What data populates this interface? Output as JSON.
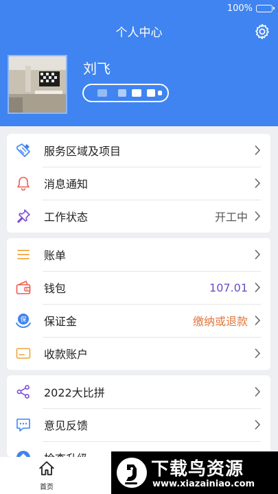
{
  "status_bar": {
    "battery": "100%"
  },
  "header": {
    "title": "个人中心",
    "settings_icon": "gear-icon"
  },
  "profile": {
    "name": "刘飞"
  },
  "menu_group_1": [
    {
      "label": "服务区域及项目",
      "value": "",
      "icon": "service-area-icon"
    },
    {
      "label": "消息通知",
      "value": "",
      "icon": "bell-icon"
    },
    {
      "label": "工作状态",
      "value": "开工中",
      "icon": "pin-icon"
    }
  ],
  "menu_group_2": [
    {
      "label": "账单",
      "value": "",
      "icon": "list-icon"
    },
    {
      "label": "钱包",
      "value": "107.01",
      "icon": "wallet-icon"
    },
    {
      "label": "保证金",
      "value": "缴纳或退款",
      "icon": "deposit-icon"
    },
    {
      "label": "收款账户",
      "value": "",
      "icon": "card-icon"
    }
  ],
  "menu_group_3": [
    {
      "label": "2022大比拼",
      "value": "",
      "icon": "share-icon"
    },
    {
      "label": "意见反馈",
      "value": "",
      "icon": "feedback-icon"
    },
    {
      "label": "检查升级",
      "value": "",
      "icon": "upgrade-icon"
    }
  ],
  "colors": {
    "header_bg": "#3f84f0",
    "wallet_value": "#6a4bc4",
    "deposit_value": "#e0773f"
  },
  "tabbar": {
    "home_label": "首页"
  },
  "watermark": {
    "title": "下载鸟资源",
    "url": "www.xiazainiao.com"
  }
}
